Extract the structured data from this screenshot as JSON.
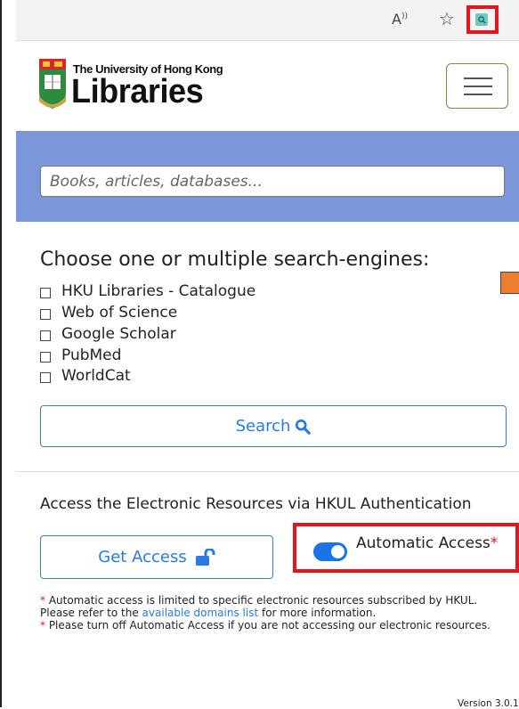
{
  "browser": {
    "read_aloud_icon": "A‑ʾ",
    "favorite_icon": "☆",
    "extension_icon": "search-icon"
  },
  "header": {
    "logo_small": "The University of Hong Kong",
    "logo_big": "Libraries"
  },
  "search": {
    "placeholder": "Books, articles, databases..."
  },
  "engines": {
    "title": "Choose one or multiple search-engines:",
    "items": [
      {
        "label": "HKU Libraries - Catalogue",
        "checked": false
      },
      {
        "label": "Web of Science",
        "checked": false
      },
      {
        "label": "Google Scholar",
        "checked": false
      },
      {
        "label": "PubMed",
        "checked": false
      },
      {
        "label": "WorldCat",
        "checked": false
      }
    ],
    "search_label": "Search"
  },
  "access": {
    "title": "Access the Electronic Resources via HKUL Authentication",
    "get_access_label": "Get Access",
    "automatic_label": "Automatic Access",
    "automatic_star": "*",
    "automatic_on": true
  },
  "notes": {
    "line1_star": "*",
    "line1_a": " Automatic access is limited to specific electronic resources subscribed by HKUL. Please refer to the ",
    "line1_link": "available domains list",
    "line1_b": " for more information.",
    "line2_star": "*",
    "line2": " Please turn off Automatic Access if you are not accessing our electronic resources."
  },
  "version": "Version 3.0.1",
  "colors": {
    "band": "#7b97d9",
    "accent": "#2a7ae2",
    "highlight": "#e4161b",
    "orange": "#ef7d2f"
  }
}
